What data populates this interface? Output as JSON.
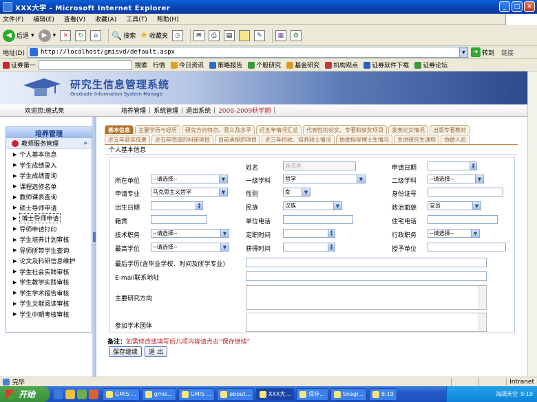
{
  "window": {
    "title": "XXX大学 - Microsoft Internet Explorer"
  },
  "menu": [
    "文件(F)",
    "编辑(E)",
    "查看(V)",
    "收藏(A)",
    "工具(T)",
    "帮助(H)"
  ],
  "toolbar": {
    "back": "后退",
    "search": "搜索",
    "favorites": "收藏夹"
  },
  "address": {
    "label": "地址(D)",
    "url": "http://localhost/gmisvd/default.aspx",
    "go": "转到",
    "links": "链接"
  },
  "linkbar": {
    "brand": "证券第一",
    "search": "搜索",
    "market": "行情",
    "items": [
      "今日资讯",
      "策略报告",
      "个股研究",
      "基金研究",
      "机构观点",
      "证券软件下载",
      "证券论坛"
    ]
  },
  "banner": {
    "title": "研究生信息管理系统",
    "subtitle": "Graduate Information System Manage"
  },
  "nav": {
    "welcome": "欢迎您:施式亮",
    "items": [
      "培养管理",
      "系统管理",
      "退出系统"
    ],
    "term": "2008-2009秋学期"
  },
  "sidebar": {
    "header": "培养管理",
    "group": "教师服务管理",
    "items": [
      "个人基本信息",
      "学生成绩录入",
      "学生成绩查询",
      "课程选修名单",
      "教师课表查询",
      "硕士导师申请",
      "博士导师申请",
      "导师申请打印",
      "学生培养计划审核",
      "导师所带学生查询",
      "论文及科研信息维护",
      "学生社会实践审核",
      "学生教学实践审核",
      "学生学术报告审核",
      "学生文献阅读审核",
      "学生中期考核审核"
    ],
    "active_index": 6
  },
  "tabs": {
    "row1": [
      "基本信息",
      "主要学历与经历",
      "研究方向特点、意义及水平",
      "近五年情况汇总",
      "代表性的论文、专著和获奖项目",
      "发表论文情况",
      "出版专著教材"
    ],
    "row2": [
      "近五年获奖成果",
      "近五年完成的科研项目",
      "目前承担的项目",
      "近三年招收、培养硕士情况",
      "协助指导博士生情况",
      "主讲研究生课程",
      "协助人员"
    ]
  },
  "section": {
    "title": "个人基本信息"
  },
  "form": {
    "name_label": "姓名",
    "name_value": "施式亮",
    "apply_date_label": "申请日期",
    "unit_label": "所在单位",
    "unit_value": "--请选择--",
    "discipline1_label": "一级学科",
    "discipline1_value": "哲学",
    "discipline2_label": "二级学科",
    "discipline2_value": "--请选择--",
    "major_label": "申请专业",
    "major_value": "马克思主义哲学",
    "gender_label": "性别",
    "gender_value": "女",
    "id_label": "身份证号",
    "birth_label": "出生日期",
    "ethnic_label": "民族",
    "ethnic_value": "汉族",
    "political_label": "政治面貌",
    "political_value": "党员",
    "native_label": "籍贯",
    "unitphone_label": "单位电话",
    "homephone_label": "住宅电话",
    "techtitle_label": "技术职务",
    "techtitle_value": "--请选择--",
    "tenure_label": "定职时间",
    "admin_label": "行政职务",
    "admin_value": "--请选择--",
    "degree_label": "最高学位",
    "degree_value": "--请选择--",
    "gettime_label": "获得时间",
    "grantunit_label": "授予单位",
    "edu_label": "最后学历(含毕业学校、时间及所学专业)",
    "email_label": "E-mail联系地址",
    "research_label": "主要研究方向",
    "society_label": "参加学术团体"
  },
  "note": {
    "prefix": "备注：",
    "text": "如需修改或填写后几项内容请点击“保存继续”"
  },
  "buttons": {
    "save": "保存继续",
    "exit": "退 出"
  },
  "status": {
    "text": "完毕",
    "zone": "Intranet"
  },
  "taskbar": {
    "start": "开始",
    "tasks": [
      "GMIS ...",
      "gmis...",
      "GMIS ...",
      "about...",
      "XXX大...",
      "保存...",
      "SnagI...",
      "8:19"
    ],
    "active_index": 4,
    "clock": "9:19",
    "tray_text": "海阔天空"
  },
  "colors": {
    "tab_active": "#b4742d",
    "banner_text": "#2b4fa3",
    "term": "#c5222a",
    "note": "#c5222a"
  }
}
